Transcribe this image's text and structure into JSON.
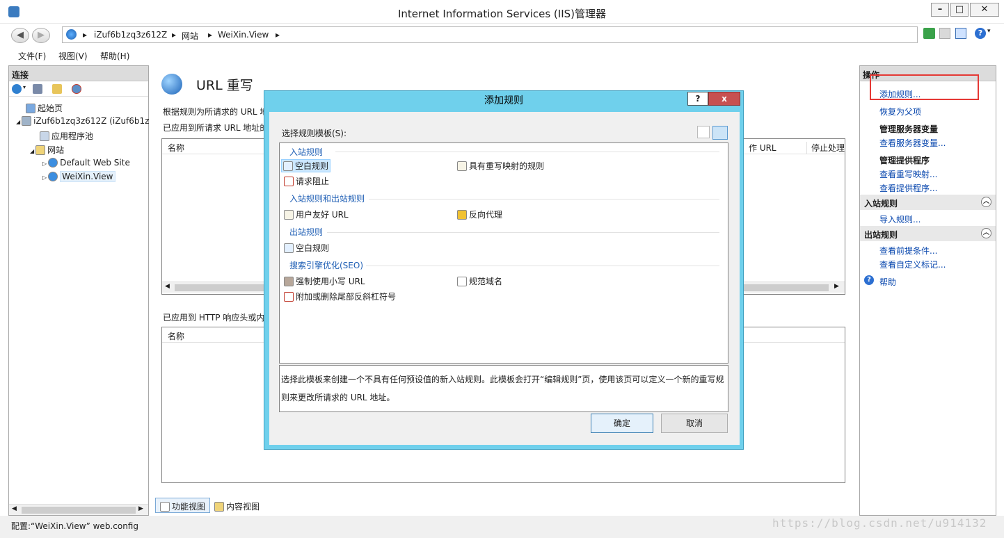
{
  "window": {
    "title": "Internet Information Services (IIS)管理器"
  },
  "address": {
    "crumbs": [
      "iZuf6b1zq3z612Z",
      "网站",
      "WeiXin.View"
    ]
  },
  "menu": {
    "items": [
      "文件(F)",
      "视图(V)",
      "帮助(H)"
    ]
  },
  "connections": {
    "header": "连接",
    "tree": [
      "起始页",
      "iZuf6b1zq3z612Z (iZuf6b1z",
      "应用程序池",
      "网站",
      "Default Web Site",
      "WeiXin.View"
    ]
  },
  "center": {
    "title": "URL 重写",
    "desc": "根据规则为所请求的 URL 地",
    "applied_url_label": "已应用到所请求 URL 地址的",
    "applied_http_label": "已应用到 HTTP 响应头或内",
    "col_name": "名称",
    "col_name2": "名称",
    "col_rewrite": "作 URL",
    "col_stop": "停止处理",
    "tab_feature": "功能视图",
    "tab_content": "内容视图"
  },
  "actions": {
    "header": "操作",
    "add_rule": "添加规则...",
    "revert": "恢复为父项",
    "manage_server_vars": "管理服务器变量",
    "view_server_vars": "查看服务器变量...",
    "manage_providers": "管理提供程序",
    "view_rewrite_maps": "查看重写映射...",
    "view_providers": "查看提供程序...",
    "inbound_group": "入站规则",
    "import_rules": "导入规则...",
    "outbound_group": "出站规则",
    "view_preconditions": "查看前提条件...",
    "view_custom_tags": "查看自定义标记...",
    "help": "帮助"
  },
  "status": {
    "text": "配置:“WeiXin.View” web.config"
  },
  "watermark": "https://blog.csdn.net/u914132",
  "dialog": {
    "title": "添加规则",
    "help_btn": "?",
    "close_btn": "x",
    "select_label": "选择规则模板(S):",
    "cat_inbound": "入站规则",
    "blank_rule": "空白规则",
    "rewrite_map_rule": "具有重写映射的规则",
    "request_block": "请求阻止",
    "cat_in_out": "入站规则和出站规则",
    "friendly_url": "用户友好 URL",
    "reverse_proxy": "反向代理",
    "cat_outbound": "出站规则",
    "blank_rule_out": "空白规则",
    "cat_seo": "搜索引擎优化(SEO)",
    "lowercase": "强制使用小写 URL",
    "canonical": "规范域名",
    "trailing_slash": "附加或删除尾部反斜杠符号",
    "description": "选择此模板来创建一个不具有任何预设值的新入站规则。此模板会打开“编辑规则”页，使用该页可以定义一个新的重写规则来更改所请求的 URL 地址。",
    "ok": "确定",
    "cancel": "取消"
  }
}
